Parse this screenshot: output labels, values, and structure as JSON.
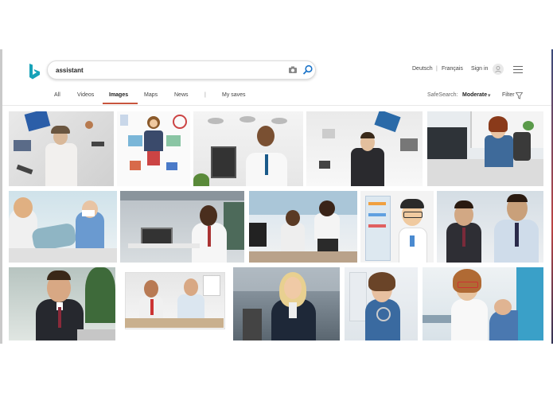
{
  "search": {
    "query": "assistant"
  },
  "header": {
    "lang1": "Deutsch",
    "lang_sep": "|",
    "lang2": "Français",
    "sign_in": "Sign in"
  },
  "tabs": [
    {
      "label": "All"
    },
    {
      "label": "Videos"
    },
    {
      "label": "Images"
    },
    {
      "label": "Maps"
    },
    {
      "label": "News"
    },
    {
      "label": "|"
    },
    {
      "label": "My saves"
    }
  ],
  "filters": {
    "safesearch_label": "SafeSearch:",
    "safesearch_value": "Moderate",
    "safesearch_caret": "▾",
    "filter_label": "Filter"
  },
  "colors": {
    "accent": "#c8553d",
    "logo": "#17a2b8"
  },
  "results": [
    "assistant-multitask-woman",
    "office-assistant-illustration",
    "call-center-operator",
    "multitask-businessman",
    "receptionist-at-desk",
    "dental-assistant",
    "businessman-at-laptop",
    "office-team-desk",
    "pharmacist-illustration",
    "call-center-team",
    "businessman-portrait",
    "office-meeting",
    "businesswoman-smiling",
    "nurse-in-scrubs",
    "dental-chair-patient"
  ]
}
